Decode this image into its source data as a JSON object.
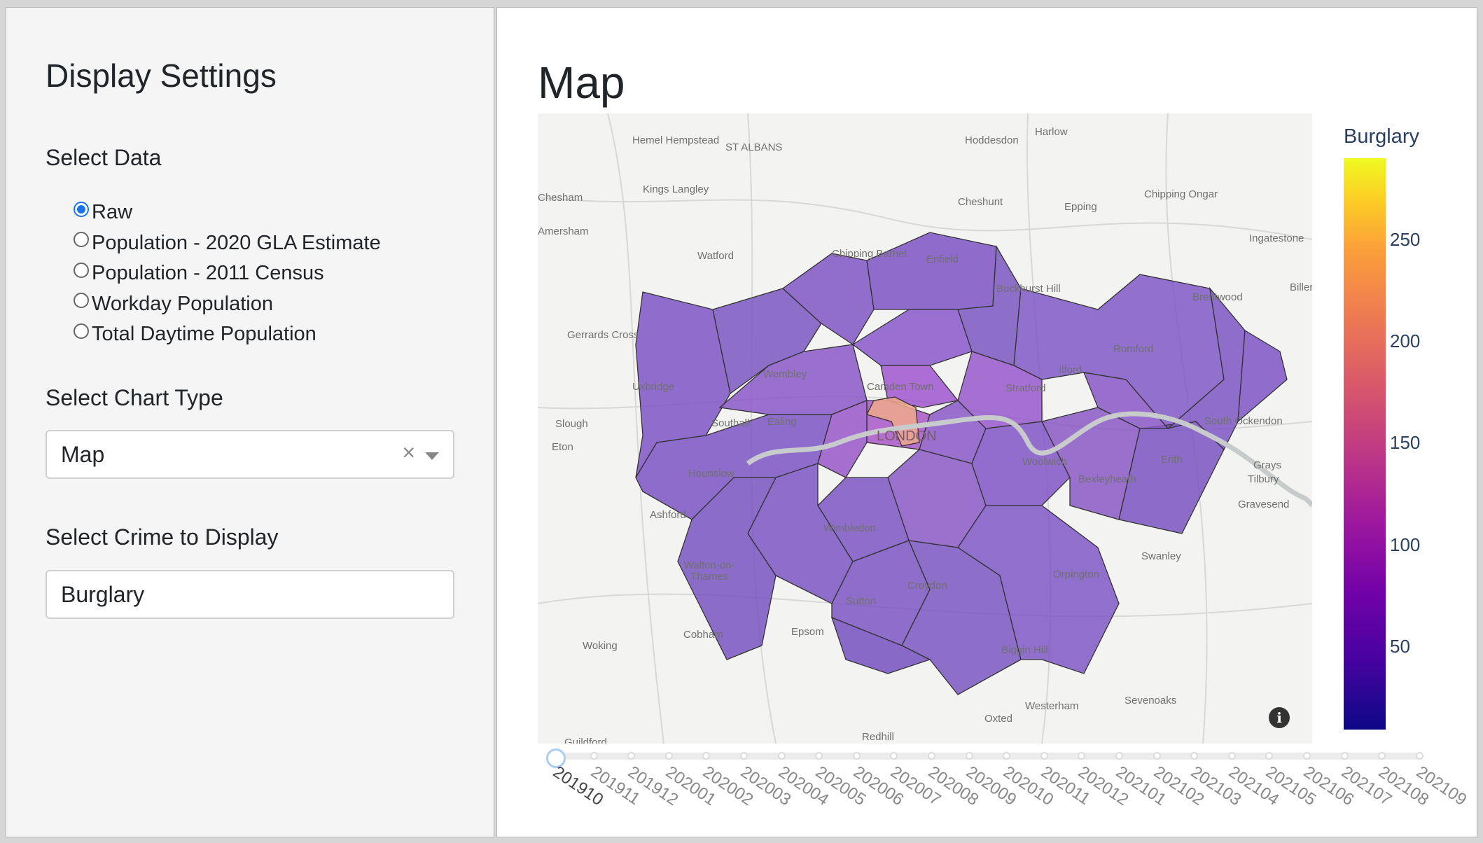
{
  "sidebar": {
    "title": "Display Settings",
    "select_data_label": "Select Data",
    "data_options": [
      {
        "label": "Raw",
        "checked": true
      },
      {
        "label": "Population - 2020 GLA Estimate",
        "checked": false
      },
      {
        "label": "Population - 2011 Census",
        "checked": false
      },
      {
        "label": "Workday Population",
        "checked": false
      },
      {
        "label": "Total Daytime Population",
        "checked": false
      }
    ],
    "chart_type_label": "Select Chart Type",
    "chart_type_value": "Map",
    "crime_label": "Select Crime to Display",
    "crime_value": "Burglary"
  },
  "main": {
    "title": "Map",
    "map_places": [
      "Harlow",
      "Hoddesdon",
      "Hemel Hempstead",
      "ST ALBANS",
      "Chesham",
      "Kings Langley",
      "Cheshunt",
      "Epping",
      "Chipping Ongar",
      "Amersham",
      "Watford",
      "Chipping Barnet",
      "Enfield",
      "Ingatestone",
      "Buckhurst Hill",
      "Brentwood",
      "Billeri",
      "Gerrards Cross",
      "Romford",
      "Wembley",
      "Camden Town",
      "Stratford",
      "Ilford",
      "Uxbridge",
      "Slough",
      "Southall",
      "Ealing",
      "LONDON",
      "South Ockendon",
      "Eton",
      "Grays",
      "Hounslow",
      "Woolwich",
      "Erith",
      "Bexleyheath",
      "Tilbury",
      "Gravesend",
      "Ashford",
      "Wimbledon",
      "Swanley",
      "Walton-on-Thames",
      "Sutton",
      "Croydon",
      "Orpington",
      "Cobham",
      "Epsom",
      "Woking",
      "Biggin Hill",
      "Westerham",
      "Sevenoaks",
      "Oxted",
      "Redhill",
      "Guildford"
    ],
    "colorbar": {
      "title": "Burglary",
      "ticks": [
        "250",
        "200",
        "150",
        "100",
        "50"
      ],
      "range": [
        15,
        295
      ]
    },
    "slider": {
      "labels": [
        "201910",
        "201911",
        "201912",
        "202001",
        "202002",
        "202003",
        "202004",
        "202005",
        "202006",
        "202007",
        "202008",
        "202009",
        "202010",
        "202011",
        "202012",
        "202101",
        "202102",
        "202103",
        "202104",
        "202105",
        "202106",
        "202107",
        "202108",
        "202109"
      ],
      "active_index": 0
    }
  }
}
